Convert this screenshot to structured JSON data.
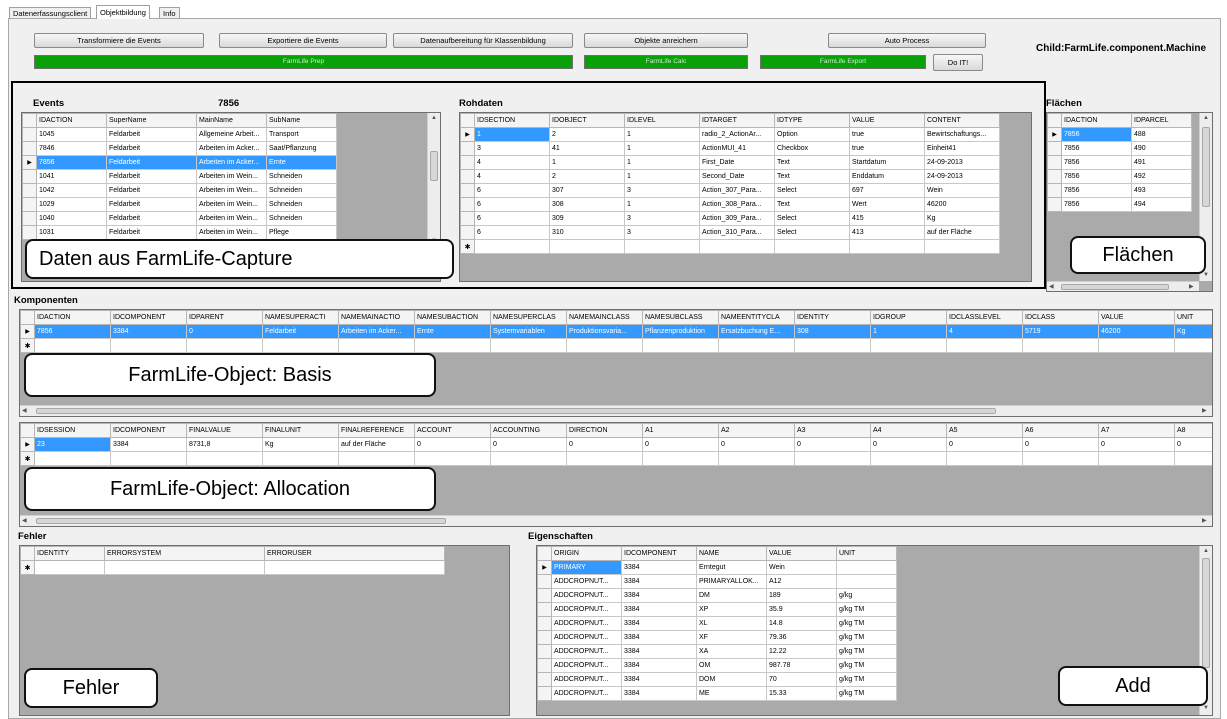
{
  "tabs": [
    "Datenerfassungsclient",
    "Objektbildung",
    "Info"
  ],
  "buttons": {
    "transform": "Transformiere die Events",
    "export": "Exportiere die Events",
    "prepare": "Datenaufbereitung für Klassenbildung",
    "enrich": "Objekte anreichern",
    "auto": "Auto Process",
    "doit": "Do IT!"
  },
  "progress": {
    "prep": "FarmLife Prep",
    "calc": "FarmLife Calc",
    "export": "FarmLife Export",
    "color": "#08a208"
  },
  "child_label": "Child:FarmLife.component.Machine",
  "events": {
    "title": "Events",
    "count": "7856",
    "columns": [
      "IDACTION",
      "SuperName",
      "MainName",
      "SubName"
    ],
    "rows": [
      [
        "1045",
        "Feldarbeit",
        "Allgemeine Arbeit...",
        "Transport"
      ],
      [
        "7846",
        "Feldarbeit",
        "Arbeiten im Acker...",
        "Saat/Pflanzung"
      ],
      [
        "7856",
        "Feldarbeit",
        "Arbeiten im Acker...",
        "Ernte"
      ],
      [
        "1041",
        "Feldarbeit",
        "Arbeiten im Wein...",
        "Schneiden"
      ],
      [
        "1042",
        "Feldarbeit",
        "Arbeiten im Wein...",
        "Schneiden"
      ],
      [
        "1029",
        "Feldarbeit",
        "Arbeiten im Wein...",
        "Schneiden"
      ],
      [
        "1040",
        "Feldarbeit",
        "Arbeiten im Wein...",
        "Schneiden"
      ],
      [
        "1031",
        "Feldarbeit",
        "Arbeiten im Wein...",
        "Pflege"
      ]
    ]
  },
  "rohdaten": {
    "title": "Rohdaten",
    "columns": [
      "IDSECTION",
      "IDOBJECT",
      "IDLEVEL",
      "IDTARGET",
      "IDTYPE",
      "VALUE",
      "CONTENT"
    ],
    "rows": [
      [
        "1",
        "2",
        "1",
        "radio_2_ActionAr...",
        "Option",
        "true",
        "Bewirtschaftungs..."
      ],
      [
        "3",
        "41",
        "1",
        "ActionMUI_41",
        "Checkbox",
        "true",
        "Einheit41"
      ],
      [
        "4",
        "1",
        "1",
        "First_Date",
        "Text",
        "Startdatum",
        "24-09-2013"
      ],
      [
        "4",
        "2",
        "1",
        "Second_Date",
        "Text",
        "Enddatum",
        "24-09-2013"
      ],
      [
        "6",
        "307",
        "3",
        "Action_307_Para...",
        "Select",
        "697",
        "Wein"
      ],
      [
        "6",
        "308",
        "1",
        "Action_308_Para...",
        "Text",
        "Wert",
        "46200"
      ],
      [
        "6",
        "309",
        "3",
        "Action_309_Para...",
        "Select",
        "415",
        "Kg"
      ],
      [
        "6",
        "310",
        "3",
        "Action_310_Para...",
        "Select",
        "413",
        "auf der Fläche"
      ]
    ]
  },
  "flaechen": {
    "title": "Flächen",
    "columns": [
      "IDACTION",
      "IDPARCEL"
    ],
    "rows": [
      [
        "7856",
        "488"
      ],
      [
        "7856",
        "490"
      ],
      [
        "7856",
        "491"
      ],
      [
        "7856",
        "492"
      ],
      [
        "7856",
        "493"
      ],
      [
        "7856",
        "494"
      ]
    ]
  },
  "komponenten": {
    "title": "Komponenten",
    "columns": [
      "IDACTION",
      "IDCOMPONENT",
      "IDPARENT",
      "NAMESUPERACTI",
      "NAMEMAINACTIO",
      "NAMESUBACTION",
      "NAMESUPERCLAS",
      "NAMEMAINCLASS",
      "NAMESUBCLASS",
      "NAMEENTITYCLA",
      "IDENTITY",
      "IDGROUP",
      "IDCLASSLEVEL",
      "IDCLASS",
      "VALUE",
      "UNIT"
    ],
    "rows": [
      [
        "7856",
        "3384",
        "0",
        "Feldarbeit",
        "Arbeiten im Acker...",
        "Ernte",
        "Systemvariablen",
        "Produktionsvaria...",
        "Pflanzenproduktion",
        "Ersatzbuchung E...",
        "308",
        "1",
        "4",
        "5719",
        "46200",
        "Kg"
      ]
    ]
  },
  "allocation": {
    "columns": [
      "IDSESSION",
      "IDCOMPONENT",
      "FINALVALUE",
      "FINALUNIT",
      "FINALREFERENCE",
      "ACCOUNT",
      "ACCOUNTING",
      "DIRECTION",
      "A1",
      "A2",
      "A3",
      "A4",
      "A5",
      "A6",
      "A7",
      "A8"
    ],
    "rows": [
      [
        "23",
        "3384",
        "8731,8",
        "Kg",
        "auf der Fläche",
        "0",
        "0",
        "0",
        "0",
        "0",
        "0",
        "0",
        "0",
        "0",
        "0",
        "0"
      ]
    ]
  },
  "fehler": {
    "title": "Fehler",
    "columns": [
      "IDENTITY",
      "ERRORSYSTEM",
      "ERRORUSER"
    ]
  },
  "eigenschaften": {
    "title": "Eigenschaften",
    "columns": [
      "ORIGIN",
      "IDCOMPONENT",
      "NAME",
      "VALUE",
      "UNIT"
    ],
    "rows": [
      [
        "PRIMARY",
        "3384",
        "Erntegut",
        "Wein",
        ""
      ],
      [
        "ADDCROPNUT...",
        "3384",
        "PRIMARYALLOK...",
        "A12",
        ""
      ],
      [
        "ADDCROPNUT...",
        "3384",
        "DM",
        "189",
        "g/kg"
      ],
      [
        "ADDCROPNUT...",
        "3384",
        "XP",
        "35.9",
        "g/kg TM"
      ],
      [
        "ADDCROPNUT...",
        "3384",
        "XL",
        "14.8",
        "g/kg TM"
      ],
      [
        "ADDCROPNUT...",
        "3384",
        "XF",
        "79.36",
        "g/kg TM"
      ],
      [
        "ADDCROPNUT...",
        "3384",
        "XA",
        "12.22",
        "g/kg TM"
      ],
      [
        "ADDCROPNUT...",
        "3384",
        "OM",
        "987.78",
        "g/kg TM"
      ],
      [
        "ADDCROPNUT...",
        "3384",
        "DOM",
        "70",
        "g/kg TM"
      ],
      [
        "ADDCROPNUT...",
        "3384",
        "ME",
        "15.33",
        "g/kg TM"
      ]
    ]
  },
  "callouts": {
    "capture": "Daten aus FarmLife-Capture",
    "flaechen": "Flächen",
    "basis": "FarmLife-Object: Basis",
    "allocation": "FarmLife-Object: Allocation",
    "fehler": "Fehler",
    "add": "Add"
  },
  "symbols": {
    "current_row": "▶",
    "new_row": "✱",
    "scroll_up": "▲",
    "scroll_down": "▼",
    "scroll_left": "◀",
    "scroll_right": "▶",
    "thumb_grip": "III"
  }
}
